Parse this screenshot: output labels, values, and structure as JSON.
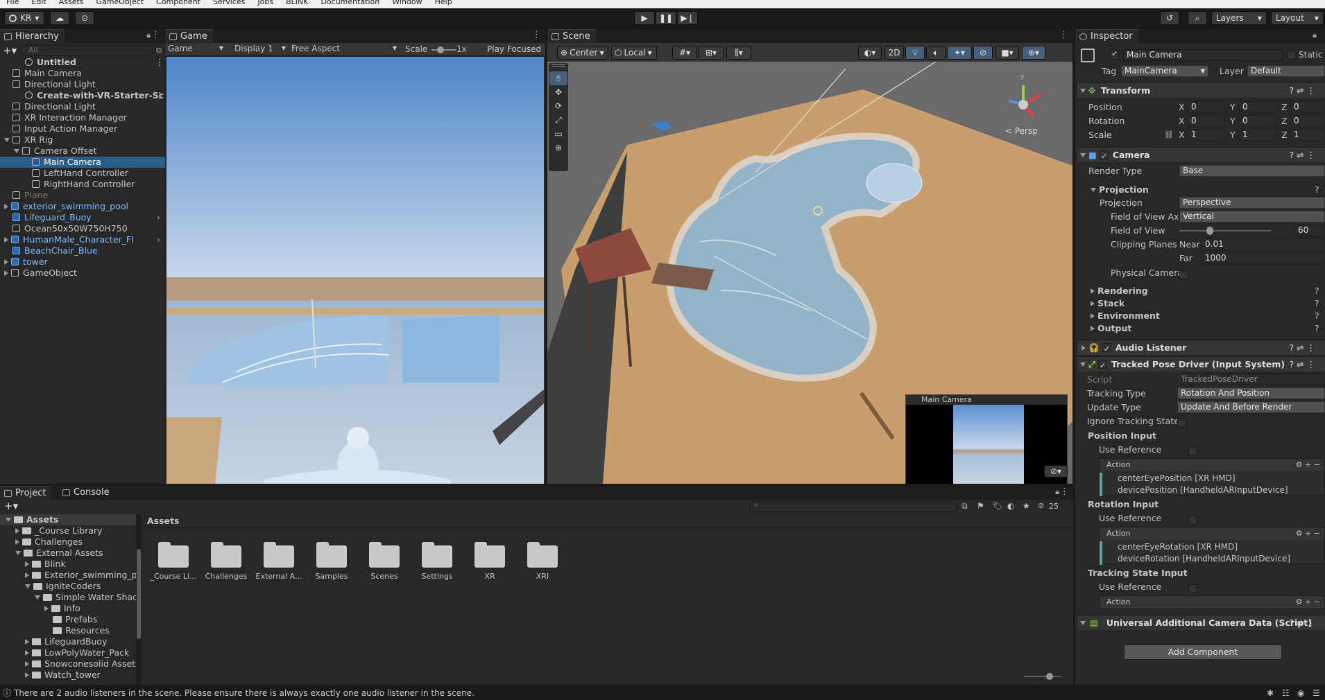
{
  "menu": [
    "File",
    "Edit",
    "Assets",
    "GameObject",
    "Component",
    "Services",
    "Jobs",
    "BLINK",
    "Documentation",
    "Window",
    "Help"
  ],
  "toolbar": {
    "account": "KR",
    "layers": "Layers",
    "layout": "Layout"
  },
  "hierarchy": {
    "tab": "Hierarchy",
    "search_placeholder": "All",
    "items": [
      {
        "label": "Untitled",
        "indent": 1,
        "kind": "scene"
      },
      {
        "label": "Main Camera",
        "indent": 2,
        "kind": "obj"
      },
      {
        "label": "Directional Light",
        "indent": 2,
        "kind": "obj"
      },
      {
        "label": "Create-with-VR-Starter-Sc",
        "indent": 1,
        "kind": "scene"
      },
      {
        "label": "Directional Light",
        "indent": 2,
        "kind": "obj"
      },
      {
        "label": "XR Interaction Manager",
        "indent": 2,
        "kind": "obj"
      },
      {
        "label": "Input Action Manager",
        "indent": 2,
        "kind": "obj"
      },
      {
        "label": "XR Rig",
        "indent": 2,
        "kind": "obj",
        "open": true
      },
      {
        "label": "Camera Offset",
        "indent": 3,
        "kind": "obj",
        "open": true
      },
      {
        "label": "Main Camera",
        "indent": 4,
        "kind": "obj",
        "selected": true
      },
      {
        "label": "LeftHand Controller",
        "indent": 4,
        "kind": "obj"
      },
      {
        "label": "RightHand Controller",
        "indent": 4,
        "kind": "obj"
      },
      {
        "label": "Plane",
        "indent": 2,
        "kind": "obj",
        "disabled": true
      },
      {
        "label": "exterior_swimming_pool",
        "indent": 2,
        "kind": "prefab",
        "closed": true
      },
      {
        "label": "Lifeguard_Buoy",
        "indent": 2,
        "kind": "prefab",
        "arrow": true
      },
      {
        "label": "Ocean50x50W750H750",
        "indent": 2,
        "kind": "obj"
      },
      {
        "label": "HumanMale_Character_Fl",
        "indent": 2,
        "kind": "prefab",
        "closed": true,
        "arrow": true
      },
      {
        "label": "BeachChair_Blue",
        "indent": 2,
        "kind": "prefab"
      },
      {
        "label": "tower",
        "indent": 2,
        "kind": "prefab",
        "closed": true
      },
      {
        "label": "GameObject",
        "indent": 2,
        "kind": "obj",
        "closed": true
      }
    ]
  },
  "game": {
    "tab": "Game",
    "mode": "Game",
    "display": "Display 1",
    "aspect": "Free Aspect",
    "scale_label": "Scale",
    "scale_value": "1x",
    "play_focused": "Play Focused"
  },
  "scene": {
    "tab": "Scene",
    "pivot": "Center",
    "space": "Local",
    "view2d": "2D",
    "persp": "< Persp",
    "preview_title": "Main Camera",
    "axis_y": "y",
    "axis_x": "x"
  },
  "inspector": {
    "tab": "Inspector",
    "object_name": "Main Camera",
    "static": "Static",
    "tag_label": "Tag",
    "tag": "MainCamera",
    "layer_label": "Layer",
    "layer": "Default",
    "transform": {
      "title": "Transform",
      "position": {
        "label": "Position",
        "x": "0",
        "y": "0",
        "z": "0"
      },
      "rotation": {
        "label": "Rotation",
        "x": "0",
        "y": "0",
        "z": "0"
      },
      "scale": {
        "label": "Scale",
        "x": "1",
        "y": "1",
        "z": "1"
      }
    },
    "camera": {
      "title": "Camera",
      "render_type_label": "Render Type",
      "render_type": "Base",
      "projection_header": "Projection",
      "projection_label": "Projection",
      "projection": "Perspective",
      "fov_axis_label": "Field of View Axis",
      "fov_axis": "Vertical",
      "fov_label": "Field of View",
      "fov": "60",
      "fov_fraction": 0.33,
      "clipping_label": "Clipping Planes",
      "near_label": "Near",
      "near": "0.01",
      "far_label": "Far",
      "far": "1000",
      "physical_label": "Physical Camera",
      "rendering": "Rendering",
      "stack": "Stack",
      "environment": "Environment",
      "output": "Output"
    },
    "audio": {
      "title": "Audio Listener"
    },
    "tpd": {
      "title": "Tracked Pose Driver (Input System)",
      "script_label": "Script",
      "script": "TrackedPoseDriver",
      "tracking_type_label": "Tracking Type",
      "tracking_type": "Rotation And Position",
      "update_type_label": "Update Type",
      "update_type": "Update And Before Render",
      "ignore_label": "Ignore Tracking State",
      "pos_input": "Position Input",
      "use_ref": "Use Reference",
      "action": "Action",
      "pos_actions": [
        "centerEyePosition [XR HMD]",
        "devicePosition [HandheldARInputDevice]"
      ],
      "rot_input": "Rotation Input",
      "rot_actions": [
        "centerEyeRotation [XR HMD]",
        "deviceRotation [HandheldARInputDevice]"
      ],
      "track_input": "Tracking State Input"
    },
    "uacd": {
      "title": "Universal Additional Camera Data (Script)"
    },
    "add_component": "Add Component"
  },
  "project": {
    "tab_project": "Project",
    "tab_console": "Console",
    "breadcrumb": "Assets",
    "hidden_count": "25",
    "tree": [
      {
        "label": "Assets",
        "indent": 0,
        "bold": true,
        "open": true
      },
      {
        "label": "_Course Library",
        "indent": 1,
        "closed": true
      },
      {
        "label": "Challenges",
        "indent": 1,
        "closed": true
      },
      {
        "label": "External Assets",
        "indent": 1,
        "open": true
      },
      {
        "label": "Blink",
        "indent": 2,
        "closed": true
      },
      {
        "label": "Exterior_swimming_pool",
        "indent": 2,
        "closed": true
      },
      {
        "label": "IgniteCoders",
        "indent": 2,
        "open": true
      },
      {
        "label": "Simple Water Shader",
        "indent": 3,
        "open": true
      },
      {
        "label": "Info",
        "indent": 4,
        "closed": true
      },
      {
        "label": "Prefabs",
        "indent": 4
      },
      {
        "label": "Resources",
        "indent": 4
      },
      {
        "label": "LifeguardBuoy",
        "indent": 2,
        "closed": true
      },
      {
        "label": "LowPolyWater_Pack",
        "indent": 2,
        "closed": true
      },
      {
        "label": "Snowconesolid Assets",
        "indent": 2,
        "closed": true
      },
      {
        "label": "Watch_tower",
        "indent": 2,
        "closed": true
      }
    ],
    "folders": [
      "_Course Li...",
      "Challenges",
      "External A...",
      "Samples",
      "Scenes",
      "Settings",
      "XR",
      "XRI"
    ]
  },
  "status": {
    "message": "There are 2 audio listeners in the scene. Please ensure there is always exactly one audio listener in the scene."
  }
}
